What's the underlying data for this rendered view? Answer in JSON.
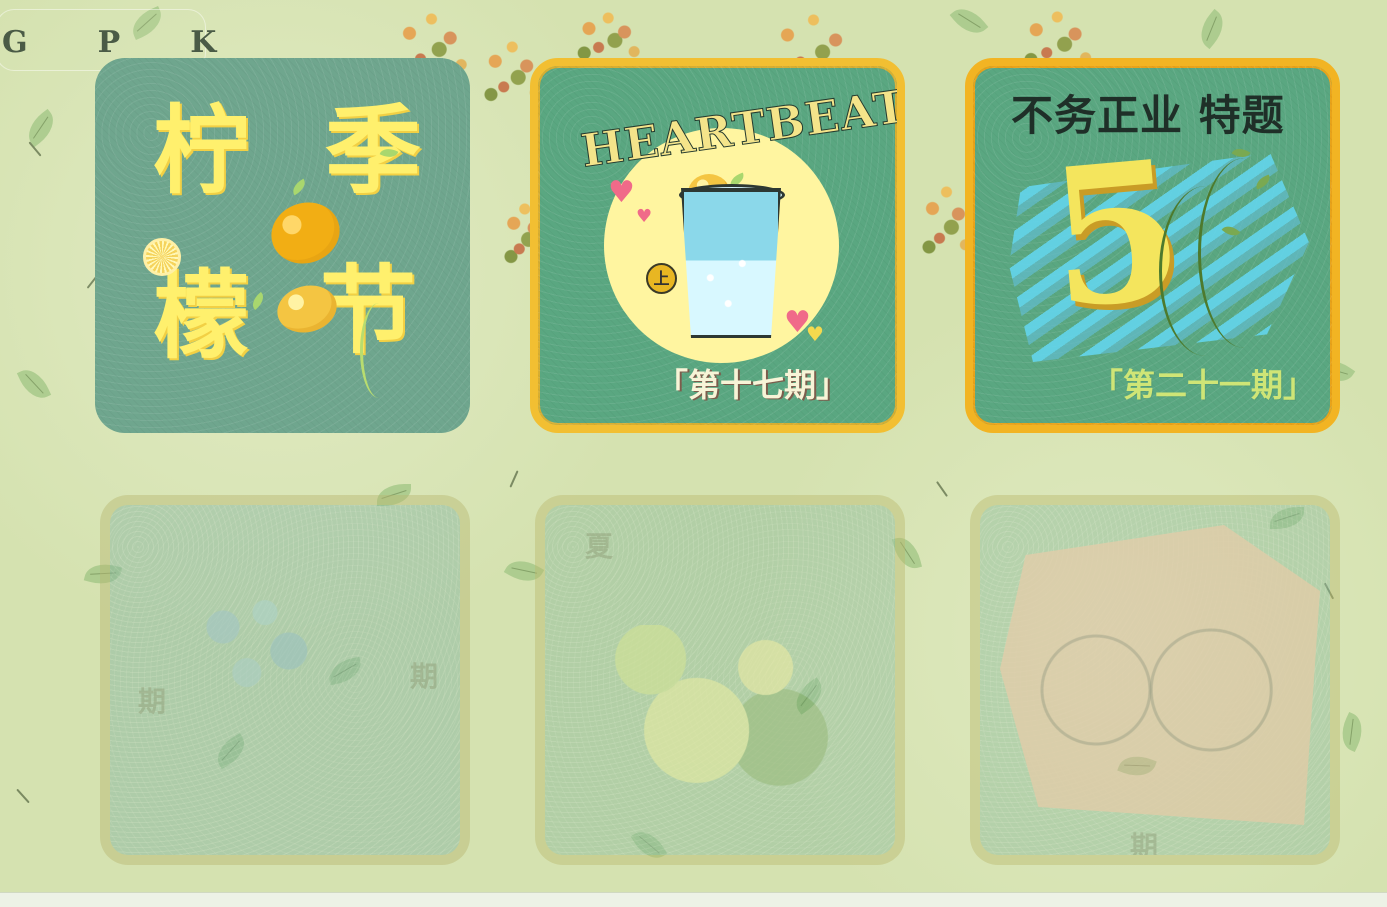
{
  "header": {
    "letters": [
      "G",
      "P",
      "K"
    ]
  },
  "cards": [
    {
      "name": "lemon-season-card",
      "lines": [
        "柠",
        "季",
        "檬",
        "节"
      ]
    },
    {
      "name": "heartbeat-card",
      "title": "HEARTBEAT",
      "badge": "上",
      "subtitle": "「第十七期」"
    },
    {
      "name": "music-card",
      "title": "不务正业 特题",
      "symbol": "5",
      "subtitle": "「第二十一期」"
    }
  ],
  "faded_cards": [
    {
      "name": "blue-flower-card",
      "text": "期"
    },
    {
      "name": "lemon-lime-card",
      "text": "夏"
    },
    {
      "name": "portrait-card",
      "text": "期"
    }
  ],
  "colors": {
    "background": "#d5e2b0",
    "tile_green": "#5aa781",
    "tile_sage": "#6fa68e",
    "accent_yellow": "#f2bf32",
    "lemon_yellow": "#fff06d"
  },
  "icons": {
    "lemon": "lemon-icon",
    "leaf": "leaf-icon",
    "heart": "heart-icon",
    "glass": "glass-icon"
  }
}
